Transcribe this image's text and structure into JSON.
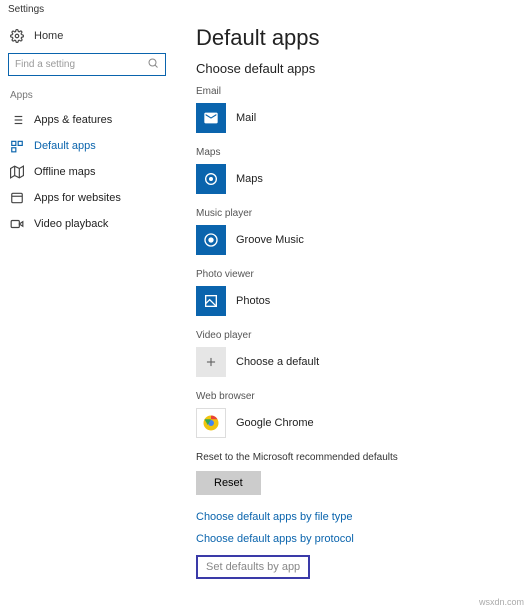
{
  "window": {
    "title": "Settings"
  },
  "sidebar": {
    "home": "Home",
    "search": {
      "placeholder": "Find a setting"
    },
    "section": "Apps",
    "items": [
      {
        "label": "Apps & features"
      },
      {
        "label": "Default apps"
      },
      {
        "label": "Offline maps"
      },
      {
        "label": "Apps for websites"
      },
      {
        "label": "Video playback"
      }
    ]
  },
  "main": {
    "title": "Default apps",
    "subheading": "Choose default apps",
    "categories": [
      {
        "label": "Email",
        "app": "Mail"
      },
      {
        "label": "Maps",
        "app": "Maps"
      },
      {
        "label": "Music player",
        "app": "Groove Music"
      },
      {
        "label": "Photo viewer",
        "app": "Photos"
      },
      {
        "label": "Video player",
        "app": "Choose a default"
      },
      {
        "label": "Web browser",
        "app": "Google Chrome"
      }
    ],
    "reset_text": "Reset to the Microsoft recommended defaults",
    "reset_button": "Reset",
    "links": [
      "Choose default apps by file type",
      "Choose default apps by protocol",
      "Set defaults by app"
    ]
  },
  "attribution": "wsxdn.com",
  "colors": {
    "accent": "#0a64ad",
    "highlight_border": "#3a3aa8"
  }
}
